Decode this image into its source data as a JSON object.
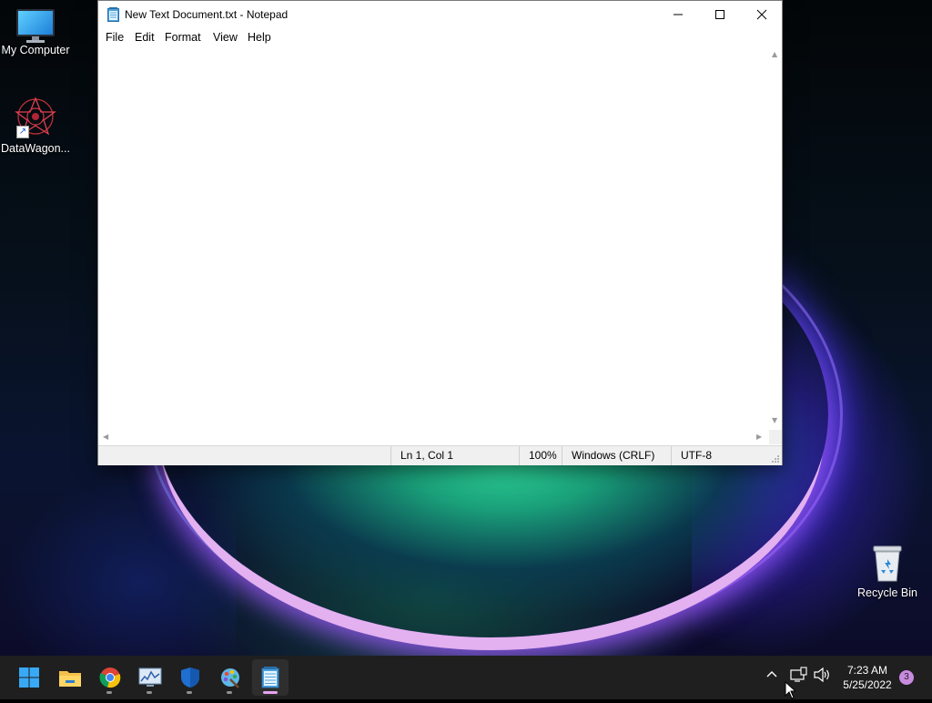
{
  "desktop": {
    "icons": [
      {
        "label": "My Computer",
        "icon": "computer-icon"
      },
      {
        "label": "DataWagon...",
        "icon": "datawagon-icon"
      },
      {
        "label": "Recycle Bin",
        "icon": "recycle-bin-icon"
      }
    ]
  },
  "window": {
    "title": "New Text Document.txt - Notepad",
    "app_icon": "notepad-icon",
    "controls": {
      "minimize": "minimize-icon",
      "maximize": "maximize-icon",
      "close": "close-icon"
    },
    "menu": [
      "File",
      "Edit",
      "Format",
      "View",
      "Help"
    ],
    "editor_text": "",
    "status": {
      "position": "Ln 1, Col 1",
      "zoom": "100%",
      "line_ending": "Windows (CRLF)",
      "encoding": "UTF-8"
    }
  },
  "taskbar": {
    "apps": [
      {
        "name": "start",
        "icon": "windows-start-icon"
      },
      {
        "name": "file-explorer",
        "icon": "folder-icon"
      },
      {
        "name": "chrome",
        "icon": "chrome-icon"
      },
      {
        "name": "resource-monitor",
        "icon": "chart-monitor-icon"
      },
      {
        "name": "security",
        "icon": "shield-icon"
      },
      {
        "name": "paint",
        "icon": "paint-palette-icon"
      },
      {
        "name": "notepad",
        "icon": "notepad-icon",
        "active": true
      }
    ],
    "tray": {
      "chevron": "chevron-up-icon",
      "network": "network-icon",
      "volume": "speaker-icon",
      "time": "7:23 AM",
      "date": "5/25/2022",
      "notifications": "3"
    }
  },
  "colors": {
    "taskbar": "#1f1f1f",
    "accent": "#e7a3f0",
    "notification_badge": "#c98be0"
  }
}
